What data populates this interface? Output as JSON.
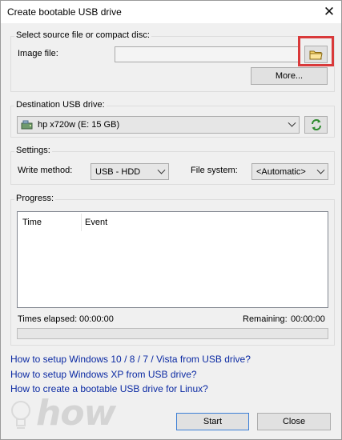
{
  "window": {
    "title": "Create bootable USB drive",
    "close_glyph": "✕"
  },
  "source": {
    "group_label": "Select source file or compact disc:",
    "image_file_label": "Image file:",
    "image_file_value": "",
    "browse_icon": "folder-icon",
    "more_button": "More..."
  },
  "destination": {
    "group_label": "Destination USB drive:",
    "drive_value": "hp x720w (E: 15 GB)",
    "drive_icon": "usb-drive-icon",
    "refresh_icon": "refresh-icon"
  },
  "settings": {
    "group_label": "Settings:",
    "write_method_label": "Write method:",
    "write_method_value": "USB - HDD",
    "file_system_label": "File system:",
    "file_system_value": "<Automatic>"
  },
  "progress": {
    "group_label": "Progress:",
    "columns": [
      "Time",
      "Event"
    ],
    "times_elapsed_label": "Times elapsed:",
    "times_elapsed_value": "00:00:00",
    "remaining_label": "Remaining:",
    "remaining_value": "00:00:00",
    "fraction": 0
  },
  "links": [
    "How to setup Windows 10 / 8 / 7 / Vista from USB drive?",
    "How to setup Windows XP from USB drive?",
    "How to create a bootable USB drive for Linux?"
  ],
  "watermark": {
    "text": "how"
  },
  "buttons": {
    "start": "Start",
    "close": "Close"
  },
  "colors": {
    "highlight": "#d9393a",
    "link": "#0b2aa3",
    "default_button_border": "#3c7fd6"
  }
}
